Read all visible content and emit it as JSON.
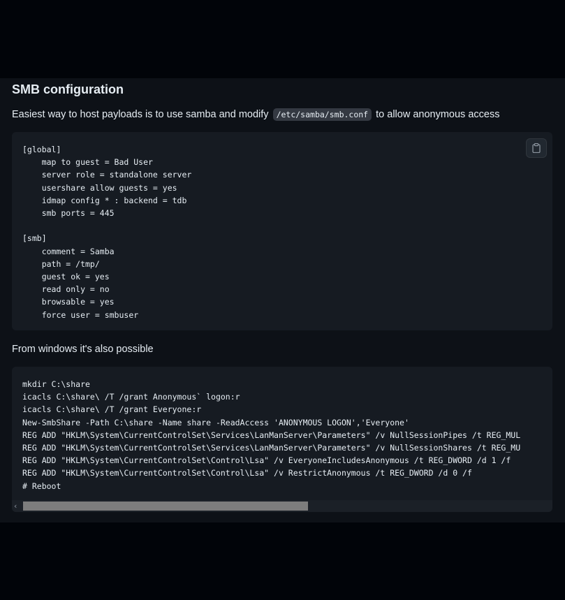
{
  "section": {
    "heading": "SMB configuration",
    "intro_before": "Easiest way to host payloads is to use samba and modify ",
    "intro_code": "/etc/samba/smb.conf",
    "intro_after": " to allow anonymous access",
    "windows_intro": "From windows it's also possible"
  },
  "smb_conf": {
    "code": "[global]\n    map to guest = Bad User\n    server role = standalone server\n    usershare allow guests = yes\n    idmap config * : backend = tdb\n    smb ports = 445\n\n[smb]\n    comment = Samba\n    path = /tmp/\n    guest ok = yes\n    read only = no\n    browsable = yes\n    force user = smbuser",
    "copy_icon": "clipboard-icon"
  },
  "windows_code": {
    "code": "mkdir C:\\share\nicacls C:\\share\\ /T /grant Anonymous` logon:r\nicacls C:\\share\\ /T /grant Everyone:r\nNew-SmbShare -Path C:\\share -Name share -ReadAccess 'ANONYMOUS LOGON','Everyone'\nREG ADD \"HKLM\\System\\CurrentControlSet\\Services\\LanManServer\\Parameters\" /v NullSessionPipes /t REG_MUL\nREG ADD \"HKLM\\System\\CurrentControlSet\\Services\\LanManServer\\Parameters\" /v NullSessionShares /t REG_MU\nREG ADD \"HKLM\\System\\CurrentControlSet\\Control\\Lsa\" /v EveryoneIncludesAnonymous /t REG_DWORD /d 1 /f\nREG ADD \"HKLM\\System\\CurrentControlSet\\Control\\Lsa\" /v RestrictAnonymous /t REG_DWORD /d 0 /f\n# Reboot",
    "scroll_left_arrow": "‹",
    "scroll_fraction_visible": 0.54
  },
  "colors": {
    "page_background": "#010409",
    "panel_background": "#0d1117",
    "code_background": "#161b22",
    "text": "#e6edf3"
  }
}
